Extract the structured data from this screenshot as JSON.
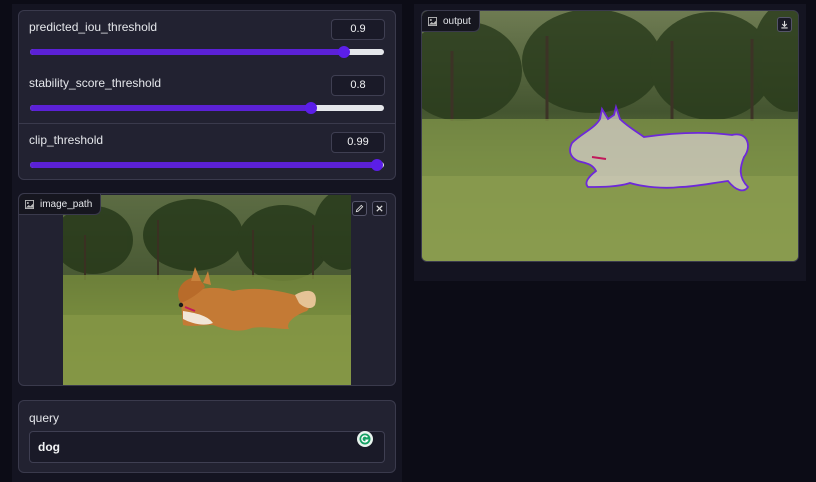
{
  "sliders": [
    {
      "label": "predicted_iou_threshold",
      "value": "0.9",
      "fraction": 0.888
    },
    {
      "label": "stability_score_threshold",
      "value": "0.8",
      "fraction": 0.794
    },
    {
      "label": "clip_threshold",
      "value": "0.99",
      "fraction": 0.98
    }
  ],
  "image_input": {
    "label": "image_path",
    "edit_icon": "pencil-icon",
    "clear_icon": "close-icon"
  },
  "query": {
    "label": "query",
    "value": "dog",
    "extension_icon": "grammarly-icon"
  },
  "output": {
    "label": "output",
    "download_icon": "download-icon"
  },
  "colors": {
    "accent": "#5b21d6",
    "mask_outline": "#6d28d9",
    "background": "#0c0c16",
    "panel": "#222231"
  }
}
